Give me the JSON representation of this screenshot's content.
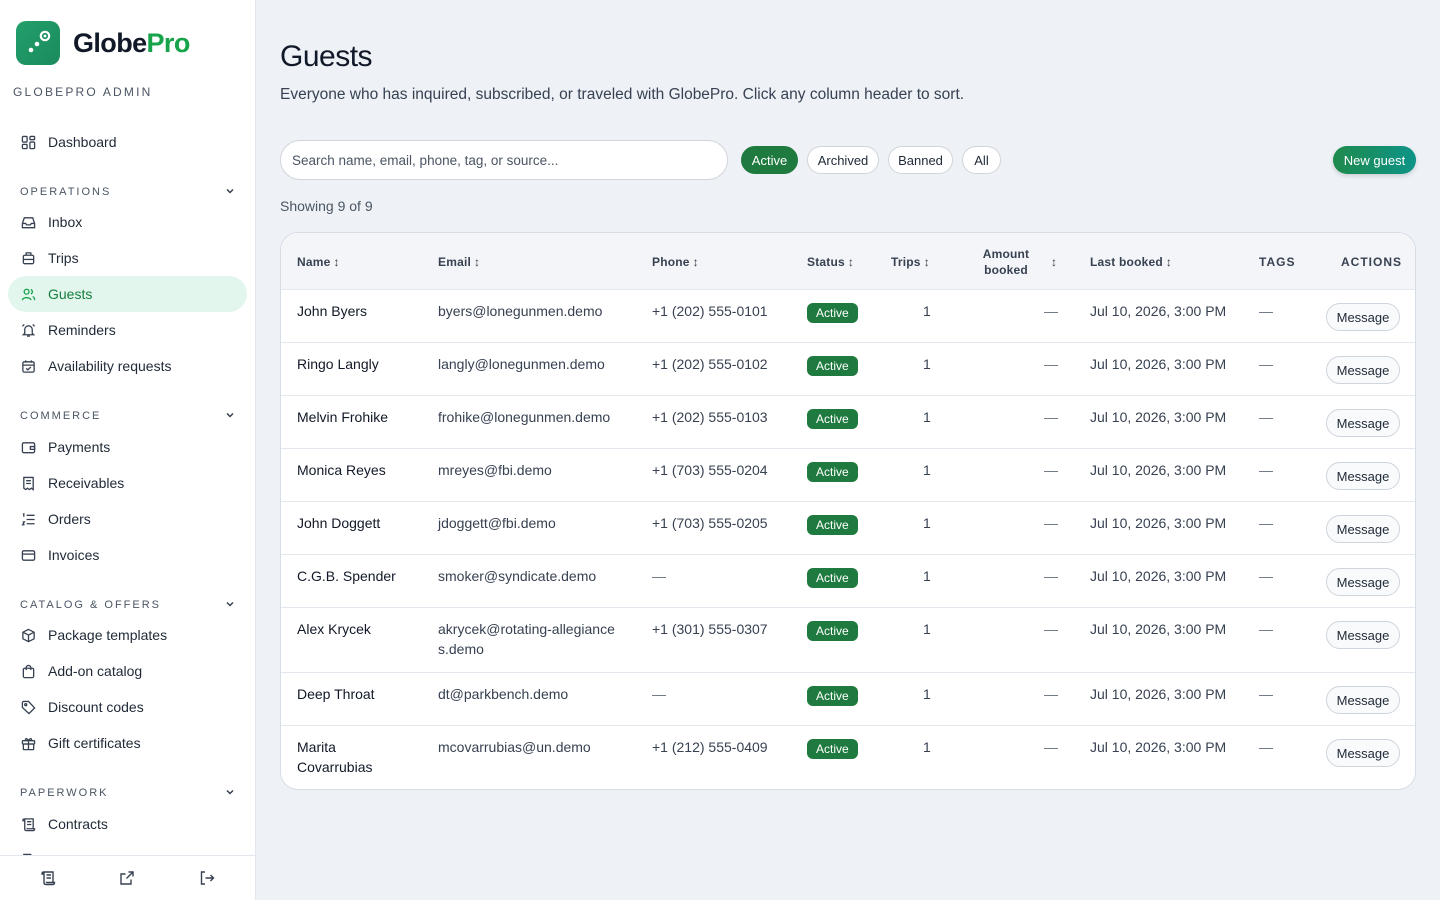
{
  "brand": {
    "name_main": "Globe",
    "name_accent": "Pro",
    "subtitle": "GLOBEPRO ADMIN"
  },
  "sidebar": {
    "dashboard": "Dashboard",
    "sections": [
      {
        "label": "OPERATIONS",
        "items": [
          "Inbox",
          "Trips",
          "Guests",
          "Reminders",
          "Availability requests"
        ]
      },
      {
        "label": "COMMERCE",
        "items": [
          "Payments",
          "Receivables",
          "Orders",
          "Invoices"
        ]
      },
      {
        "label": "CATALOG & OFFERS",
        "items": [
          "Package templates",
          "Add-on catalog",
          "Discount codes",
          "Gift certificates"
        ]
      },
      {
        "label": "PAPERWORK",
        "items": [
          "Contracts"
        ]
      }
    ],
    "active_item": "Guests"
  },
  "page": {
    "title": "Guests",
    "subtitle": "Everyone who has inquired, subscribed, or traveled with GlobePro. Click any column header to sort."
  },
  "toolbar": {
    "search_placeholder": "Search name, email, phone, tag, or source...",
    "filters": [
      "Active",
      "Archived",
      "Banned",
      "All"
    ],
    "active_filter": "Active",
    "new_button": "New guest",
    "showing": "Showing 9 of 9"
  },
  "table": {
    "headers": {
      "name": "Name",
      "email": "Email",
      "phone": "Phone",
      "status": "Status",
      "trips": "Trips",
      "amount_line1": "Amount",
      "amount_line2": "booked",
      "last_booked": "Last booked",
      "tags": "TAGS",
      "actions": "ACTIONS",
      "sort_glyph": "↕"
    },
    "action_label": "Message",
    "rows": [
      {
        "name": "John Byers",
        "email": "byers@lonegunmen.demo",
        "phone": "+1 (202) 555-0101",
        "status": "Active",
        "trips": "1",
        "amount": "—",
        "last_booked": "Jul 10, 2026, 3:00 PM",
        "tags": "—"
      },
      {
        "name": "Ringo Langly",
        "email": "langly@lonegunmen.demo",
        "phone": "+1 (202) 555-0102",
        "status": "Active",
        "trips": "1",
        "amount": "—",
        "last_booked": "Jul 10, 2026, 3:00 PM",
        "tags": "—"
      },
      {
        "name": "Melvin Frohike",
        "email": "frohike@lonegunmen.demo",
        "phone": "+1 (202) 555-0103",
        "status": "Active",
        "trips": "1",
        "amount": "—",
        "last_booked": "Jul 10, 2026, 3:00 PM",
        "tags": "—"
      },
      {
        "name": "Monica Reyes",
        "email": "mreyes@fbi.demo",
        "phone": "+1 (703) 555-0204",
        "status": "Active",
        "trips": "1",
        "amount": "—",
        "last_booked": "Jul 10, 2026, 3:00 PM",
        "tags": "—"
      },
      {
        "name": "John Doggett",
        "email": "jdoggett@fbi.demo",
        "phone": "+1 (703) 555-0205",
        "status": "Active",
        "trips": "1",
        "amount": "—",
        "last_booked": "Jul 10, 2026, 3:00 PM",
        "tags": "—"
      },
      {
        "name": "C.G.B. Spender",
        "email": "smoker@syndicate.demo",
        "phone": "—",
        "status": "Active",
        "trips": "1",
        "amount": "—",
        "last_booked": "Jul 10, 2026, 3:00 PM",
        "tags": "—"
      },
      {
        "name": "Alex Krycek",
        "email_line1": "akrycek@rotating-allegiance",
        "email_line2": "s.demo",
        "phone": "+1 (301) 555-0307",
        "status": "Active",
        "trips": "1",
        "amount": "—",
        "last_booked": "Jul 10, 2026, 3:00 PM",
        "tags": "—"
      },
      {
        "name": "Deep Throat",
        "email": "dt@parkbench.demo",
        "phone": "—",
        "status": "Active",
        "trips": "1",
        "amount": "—",
        "last_booked": "Jul 10, 2026, 3:00 PM",
        "tags": "—"
      },
      {
        "name_line1": "Marita",
        "name_line2": "Covarrubias",
        "email": "mcovarrubias@un.demo",
        "phone": "+1 (212) 555-0409",
        "status": "Active",
        "trips": "1",
        "amount": "—",
        "last_booked": "Jul 10, 2026, 3:00 PM",
        "tags": "—"
      }
    ]
  },
  "colors": {
    "accent": "#16a34a",
    "active_badge": "#1f7a3f",
    "active_nav_bg": "#e3f6ee"
  }
}
